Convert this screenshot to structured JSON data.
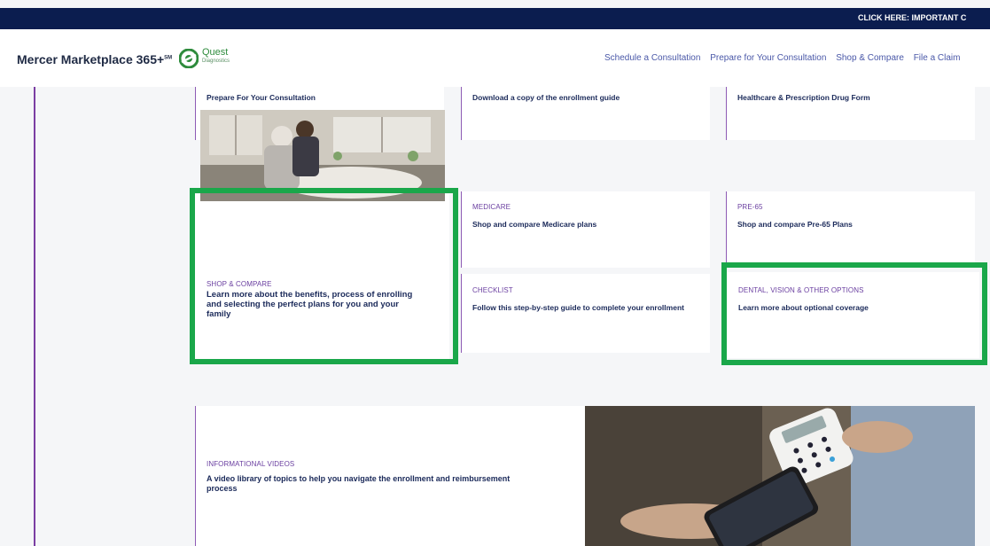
{
  "topbar": {
    "alert_text": "CLICK HERE:  IMPORTANT C"
  },
  "header": {
    "brand": "Mercer Marketplace 365+",
    "brand_mark": "SM",
    "partner_name": "Quest",
    "partner_sub": "Diagnostics",
    "nav": [
      "Schedule a Consultation",
      "Prepare for Your Consultation",
      "Shop & Compare",
      "File a Claim"
    ]
  },
  "top_cards": [
    {
      "heading": "Prepare For Your Consultation"
    },
    {
      "heading": "Download a copy of the enrollment guide"
    },
    {
      "heading": "Healthcare & Prescription Drug Form"
    }
  ],
  "shop_compare": {
    "eyebrow": "SHOP & COMPARE",
    "heading": "Learn more about the benefits, process of enrolling and selecting the perfect plans for you and your family"
  },
  "medicare": {
    "eyebrow": "MEDICARE",
    "heading": "Shop and compare Medicare plans"
  },
  "pre65": {
    "eyebrow": "PRE-65",
    "heading": "Shop and compare Pre-65 Plans"
  },
  "checklist": {
    "eyebrow": "CHECKLIST",
    "heading": "Follow this step-by-step guide to complete your enrollment"
  },
  "dental": {
    "eyebrow": "DENTAL, VISION & OTHER OPTIONS",
    "heading": "Learn more about optional coverage"
  },
  "videos": {
    "eyebrow": "INFORMATIONAL VIDEOS",
    "heading": "A video library of topics to help you navigate the enrollment and reimbursement process"
  },
  "colors": {
    "highlight": "#1aa74a",
    "accent": "#7b3ea3",
    "navy": "#0b1d4f"
  }
}
